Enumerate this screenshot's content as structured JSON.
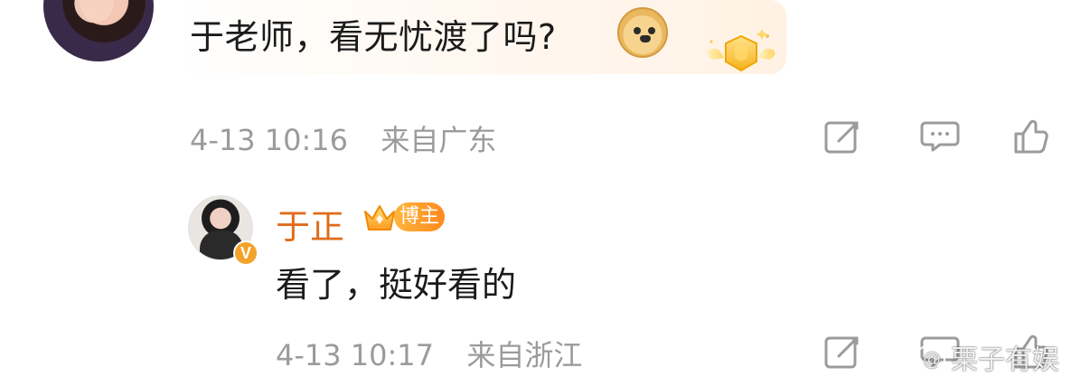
{
  "comments": [
    {
      "text": "于老师，看无忧渡了吗?",
      "timestamp": "4-13 10:16",
      "location": "来自广东"
    }
  ],
  "reply": {
    "author": "于正",
    "badge_label": "博主",
    "verified_letter": "V",
    "text": "看了，挺好看的",
    "timestamp": "4-13 10:17",
    "location": "来自浙江"
  },
  "watermark": {
    "text": "栗子有娱"
  },
  "icons": {
    "doge": "doge-emoji-icon",
    "medal": "medal-icon",
    "repost": "repost-icon",
    "comment": "comment-icon",
    "like": "like-icon",
    "crown": "crown-icon",
    "weibo": "weibo-logo-icon"
  },
  "colors": {
    "author_name": "#e06c1a",
    "meta_text": "#9b9b9b",
    "verified_badge": "#f2a32a",
    "badge_gradient_start": "#ffb43b",
    "badge_gradient_end": "#ff8a1f"
  }
}
